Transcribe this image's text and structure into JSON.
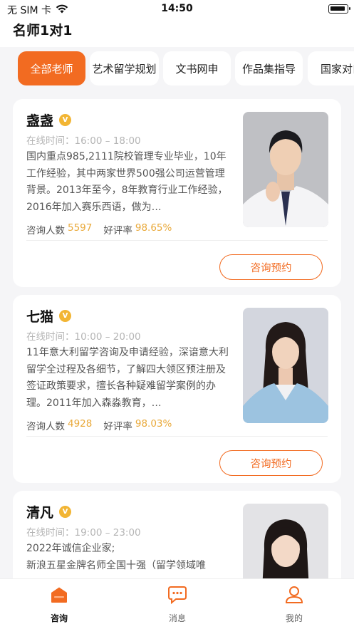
{
  "status_bar": {
    "carrier": "无 SIM 卡",
    "time": "14:50"
  },
  "header": {
    "title": "名师1对1"
  },
  "tabs": [
    {
      "label": "全部老师"
    },
    {
      "label": "艺术留学规划"
    },
    {
      "label": "文书网申"
    },
    {
      "label": "作品集指导"
    },
    {
      "label": "国家对口"
    }
  ],
  "labels": {
    "online_prefix": "在线时间：",
    "consult_count": "咨询人数",
    "rating": "好评率",
    "consult_button": "咨询预约",
    "verified": "V"
  },
  "teachers": [
    {
      "name": "盏盏",
      "online": "16:00 – 18:00",
      "desc": "国内重点985,2111院校管理专业毕业，10年工作经验，其中两家世界500强公司运营管理背景。2013年至今，8年教育行业工作经验，2016年加入赛乐西语，做为…",
      "consult_count": "5597",
      "rating": "98.65%"
    },
    {
      "name": "七猫",
      "online": "10:00 – 20:00",
      "desc": "11年意大利留学咨询及申请经验，深谙意大利留学全过程及各细节，了解四大领区预注册及签证政策要求，擅长各种疑难留学案例的办理。2011年加入森淼教育，…",
      "consult_count": "4928",
      "rating": "98.03%"
    },
    {
      "name": "清凡",
      "online": "19:00 – 23:00",
      "desc": "2022年诚信企业家;\n新浪五星金牌名师全国十强（留学领域唯",
      "consult_count": "",
      "rating": ""
    }
  ],
  "bottom_nav": [
    {
      "label": "咨询",
      "icon": "home-icon"
    },
    {
      "label": "消息",
      "icon": "chat-icon"
    },
    {
      "label": "我的",
      "icon": "user-icon"
    }
  ],
  "colors": {
    "accent": "#f26b21",
    "gold": "#e9a93a",
    "badge": "#f2b534"
  }
}
